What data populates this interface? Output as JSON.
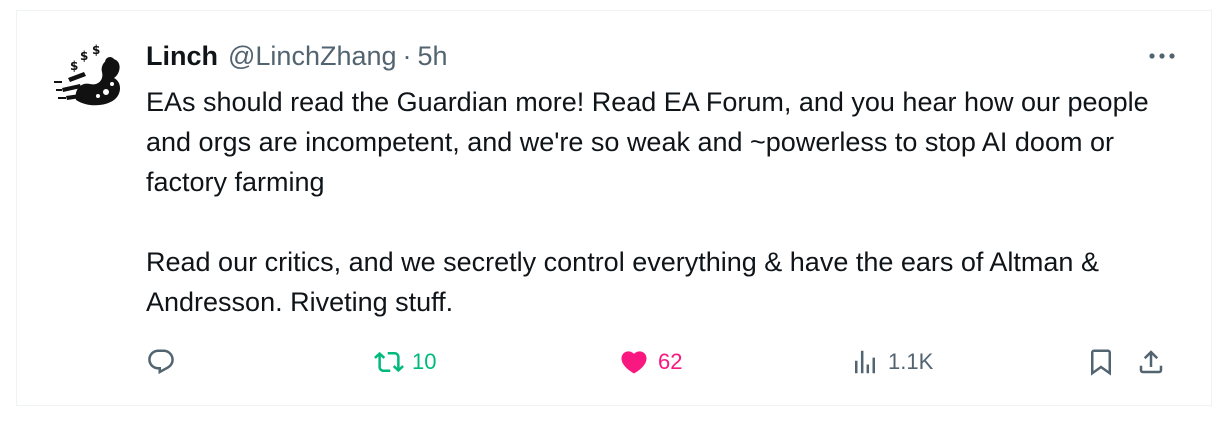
{
  "tweet": {
    "author_name": "Linch",
    "author_handle": "@LinchZhang",
    "separator": "·",
    "time": "5h",
    "paragraphs": [
      "EAs should read the Guardian more! Read EA Forum, and you hear how our people and orgs are incompetent, and we're so weak and ~powerless to stop AI doom or factory farming",
      "Read our critics, and we secretly control everything & have the ears of Altman & Andresson. Riveting stuff."
    ]
  },
  "actions": {
    "reply_icon": "reply-icon",
    "retweet_count": "10",
    "like_count": "62",
    "views_count": "1.1K",
    "bookmark_icon": "bookmark-icon",
    "share_icon": "share-icon"
  },
  "colors": {
    "text": "#0f1419",
    "secondary": "#536471",
    "retweet": "#00ba7c",
    "like": "#f91880",
    "border": "#eff3f4"
  }
}
